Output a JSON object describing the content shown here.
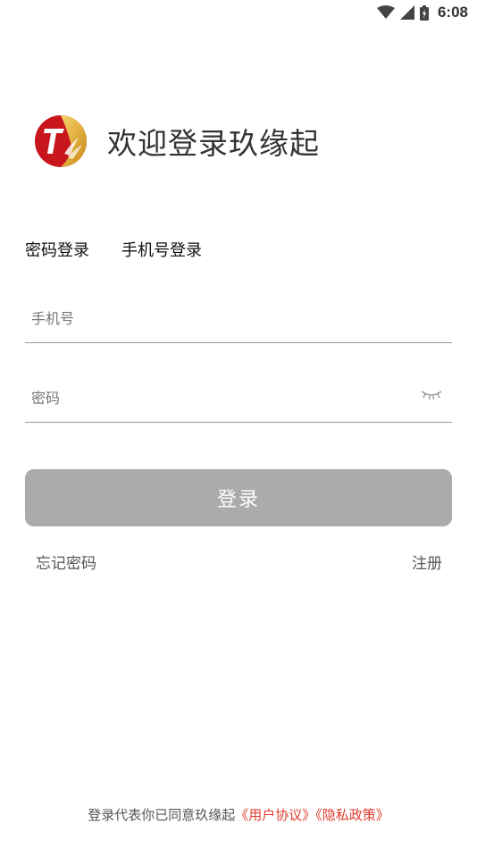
{
  "status_bar": {
    "time": "6:08",
    "icons": [
      "wifi-icon",
      "cellular-signal-icon",
      "battery-charging-icon"
    ]
  },
  "header": {
    "logo_icon": "app-logo-icon",
    "title": "欢迎登录玖缘起"
  },
  "tabs": [
    {
      "label": "密码登录"
    },
    {
      "label": "手机号登录"
    }
  ],
  "form": {
    "phone_placeholder": "手机号",
    "password_placeholder": "密码",
    "password_toggle_icon": "eye-closed-icon"
  },
  "login_button": {
    "label": "登录"
  },
  "links": {
    "forgot_password": "忘记密码",
    "register": "注册"
  },
  "footer": {
    "prefix": "登录代表你已同意玖缘起",
    "user_agreement": "《用户协议》",
    "privacy_policy": "《隐私政策》"
  },
  "colors": {
    "button_bg": "#ababab",
    "link_accent": "#e03b2e",
    "logo_red": "#c8161d",
    "logo_gold": "#e0a72a"
  }
}
